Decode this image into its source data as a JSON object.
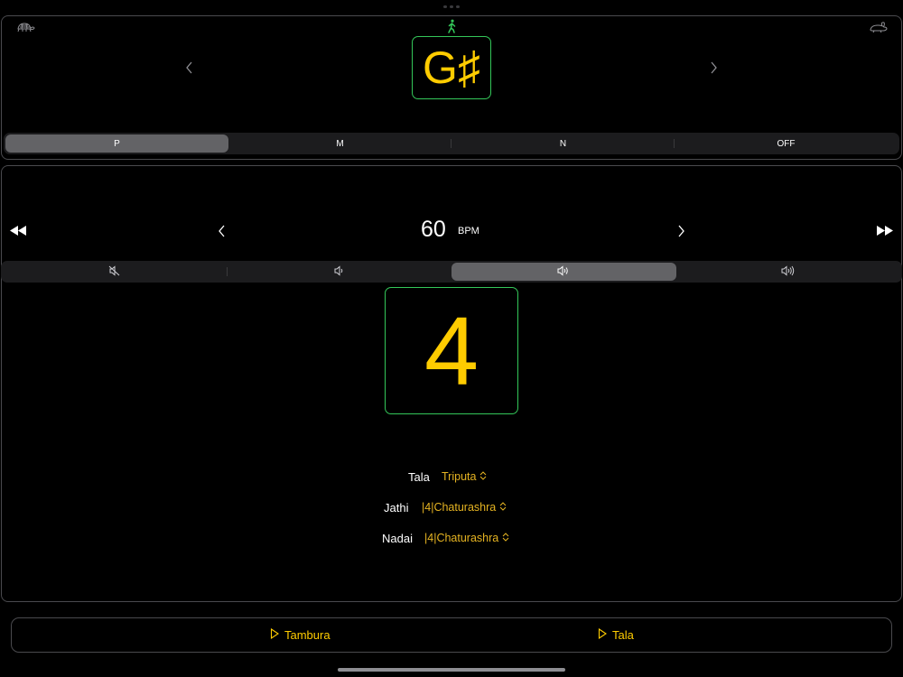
{
  "tuner": {
    "note": "G♯",
    "tanpura_options": [
      {
        "label": "P",
        "selected": true
      },
      {
        "label": "M",
        "selected": false
      },
      {
        "label": "N",
        "selected": false
      },
      {
        "label": "OFF",
        "selected": false
      }
    ]
  },
  "metronome": {
    "bpm": "60",
    "bpm_unit": "BPM",
    "current_beat": "4",
    "volume_levels": [
      {
        "icon": "speaker-mute-icon",
        "selected": false
      },
      {
        "icon": "speaker-low-icon",
        "selected": false
      },
      {
        "icon": "speaker-medium-icon",
        "selected": true
      },
      {
        "icon": "speaker-high-icon",
        "selected": false
      }
    ]
  },
  "settings": {
    "tala": {
      "label": "Tala",
      "value": "Triputa"
    },
    "jathi": {
      "label": "Jathi",
      "value": "|4|Chaturashra"
    },
    "nadai": {
      "label": "Nadai",
      "value": "|4|Chaturashra"
    }
  },
  "controls": {
    "tambura_label": "Tambura",
    "tala_label": "Tala"
  },
  "colors": {
    "accent": "#ffcc00",
    "active_border": "#34c759",
    "segment_selected": "#636366"
  }
}
